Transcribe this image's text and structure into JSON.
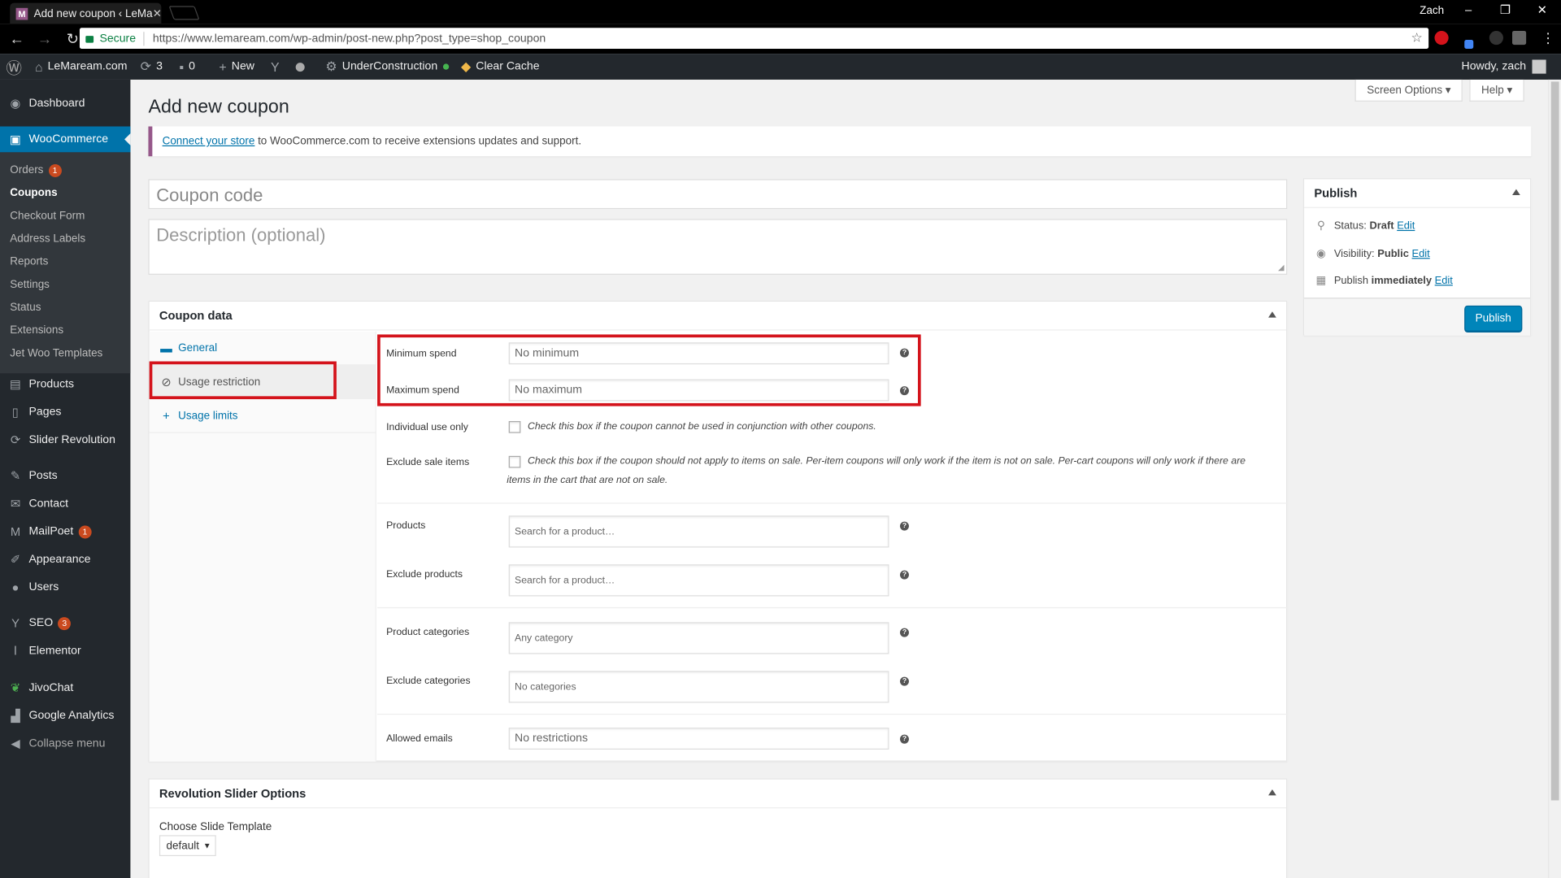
{
  "browser": {
    "tab_title": "Add new coupon ‹ LeMa",
    "tab_close": "✕",
    "user_name": "Zach",
    "minimize": "–",
    "restore": "❐",
    "close": "✕",
    "secure_label": "Secure",
    "url": "https://www.lemaream.com/wp-admin/post-new.php?post_type=shop_coupon"
  },
  "adminbar": {
    "site_name": "LeMaream.com",
    "updates_count": "3",
    "comments_count": "0",
    "new_label": "New",
    "under_construction": "UnderConstruction",
    "clear_cache": "Clear Cache",
    "howdy": "Howdy, zach"
  },
  "menu": {
    "dashboard": "Dashboard",
    "woocommerce": "WooCommerce",
    "orders": "Orders",
    "orders_badge": "1",
    "coupons": "Coupons",
    "checkout_form": "Checkout Form",
    "address_labels": "Address Labels",
    "reports": "Reports",
    "settings": "Settings",
    "status": "Status",
    "extensions": "Extensions",
    "jet_woo": "Jet Woo Templates",
    "products": "Products",
    "pages": "Pages",
    "slider_revolution": "Slider Revolution",
    "posts": "Posts",
    "contact": "Contact",
    "mailpoet": "MailPoet",
    "mailpoet_badge": "1",
    "appearance": "Appearance",
    "users": "Users",
    "seo": "SEO",
    "seo_badge": "3",
    "elementor": "Elementor",
    "jivochat": "JivoChat",
    "google_analytics": "Google Analytics",
    "collapse": "Collapse menu"
  },
  "page": {
    "title": "Add new coupon",
    "screen_options": "Screen Options ▾",
    "help": "Help ▾",
    "notice_link": "Connect your store",
    "notice_text": "to WooCommerce.com to receive extensions updates and support.",
    "coupon_code_placeholder": "Coupon code",
    "description_placeholder": "Description (optional)"
  },
  "coupon_data": {
    "heading": "Coupon data",
    "tabs": [
      {
        "label": "General"
      },
      {
        "label": "Usage restriction"
      },
      {
        "label": "Usage limits"
      }
    ],
    "min_spend_label": "Minimum spend",
    "min_spend_placeholder": "No minimum",
    "max_spend_label": "Maximum spend",
    "max_spend_placeholder": "No maximum",
    "individual_label": "Individual use only",
    "individual_desc": "Check this box if the coupon cannot be used in conjunction with other coupons.",
    "exclude_sale_label": "Exclude sale items",
    "exclude_sale_desc": "Check this box if the coupon should not apply to items on sale. Per-item coupons will only work if the item is not on sale. Per-cart coupons will only work if there are items in the cart that are not on sale.",
    "products_label": "Products",
    "products_placeholder": "Search for a product…",
    "exclude_products_label": "Exclude products",
    "exclude_products_placeholder": "Search for a product…",
    "product_categories_label": "Product categories",
    "product_categories_placeholder": "Any category",
    "exclude_categories_label": "Exclude categories",
    "exclude_categories_placeholder": "No categories",
    "allowed_emails_label": "Allowed emails",
    "allowed_emails_placeholder": "No restrictions",
    "help_glyph": "?"
  },
  "publish": {
    "heading": "Publish",
    "status_label": "Status:",
    "status_value": "Draft",
    "visibility_label": "Visibility:",
    "visibility_value": "Public",
    "publish_label": "Publish",
    "publish_value": "immediately",
    "edit": "Edit",
    "button": "Publish"
  },
  "revslider": {
    "heading": "Revolution Slider Options",
    "template_label": "Choose Slide Template",
    "template_value": "default"
  },
  "colors": {
    "accent": "#0073aa",
    "highlight": "#d4131b",
    "woo_purple": "#96588a",
    "admin_dark": "#23282d"
  }
}
